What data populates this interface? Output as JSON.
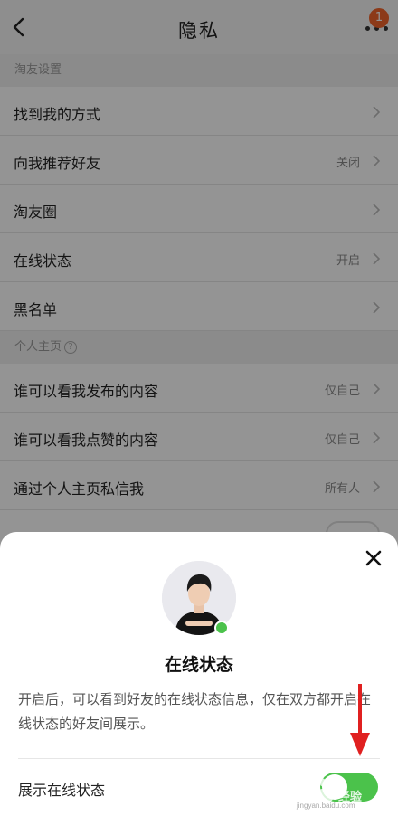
{
  "header": {
    "title": "隐私",
    "notification_count": "1"
  },
  "sections": [
    {
      "title": "淘友设置"
    },
    {
      "title": "个人主页"
    }
  ],
  "rows": [
    {
      "label": "找到我的方式",
      "value": ""
    },
    {
      "label": "向我推荐好友",
      "value": "关闭"
    },
    {
      "label": "淘友圈",
      "value": ""
    },
    {
      "label": "在线状态",
      "value": "开启"
    },
    {
      "label": "黑名单",
      "value": ""
    },
    {
      "label": "谁可以看我发布的内容",
      "value": "仅自己"
    },
    {
      "label": "谁可以看我点赞的内容",
      "value": "仅自己"
    },
    {
      "label": "通过个人主页私信我",
      "value": "所有人"
    }
  ],
  "sheet": {
    "title": "在线状态",
    "description": "开启后，可以看到好友的在线状态信息，仅在双方都开启在线状态的好友间展示。",
    "setting_label": "展示在线状态",
    "toggle_on": true,
    "toggle_color": "#4bc24b"
  },
  "watermark": {
    "text": "经验",
    "sub": "jingyan.baidu.com"
  },
  "colors": {
    "accent": "#4bc24b",
    "badge": "#f2642b",
    "annotation_arrow": "#e02020"
  }
}
